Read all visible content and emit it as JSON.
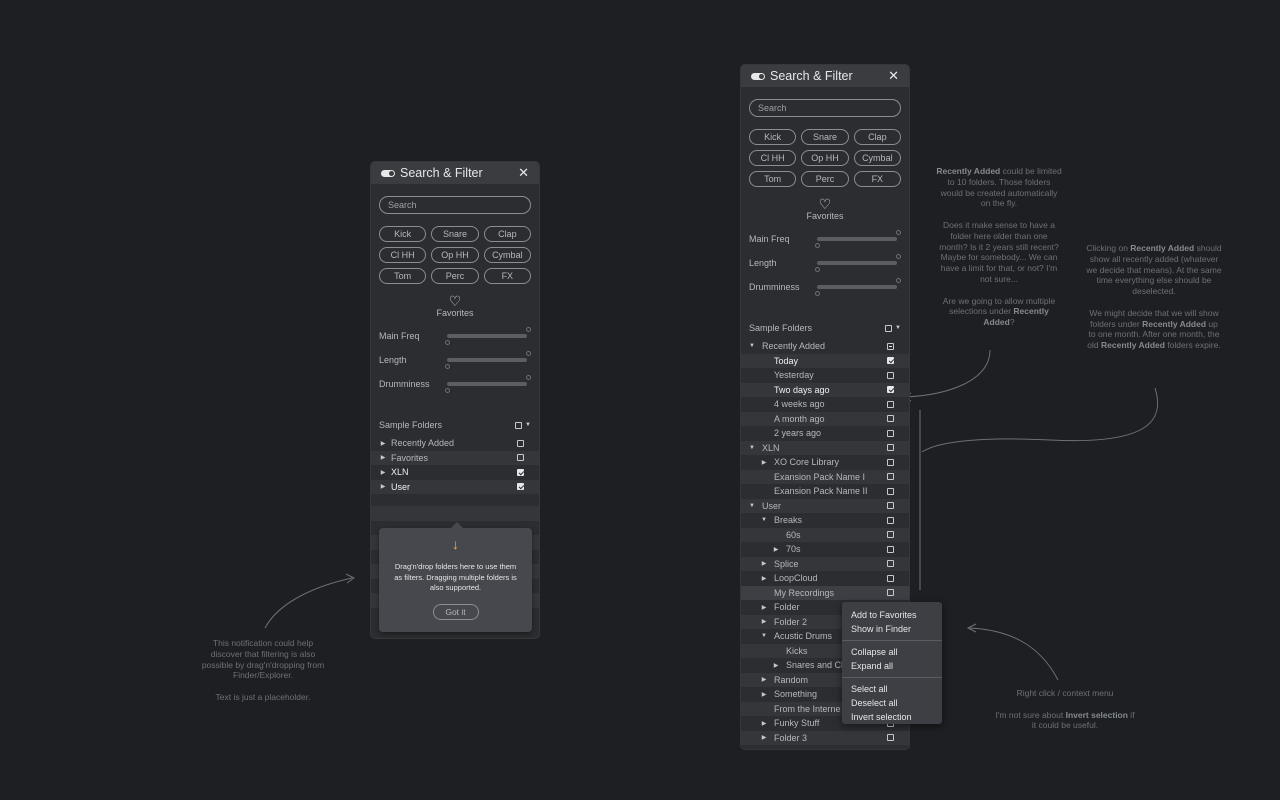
{
  "panel_left": {
    "title": "Search & Filter",
    "search_placeholder": "Search",
    "tags": [
      "Kick",
      "Snare",
      "Clap",
      "Cl HH",
      "Op HH",
      "Cymbal",
      "Tom",
      "Perc",
      "FX"
    ],
    "favorites_label": "Favorites",
    "sliders": [
      "Main Freq",
      "Length",
      "Drumminess"
    ],
    "sample_folders_label": "Sample Folders",
    "folders": [
      {
        "label": "Recently Added",
        "checked": false
      },
      {
        "label": "Favorites",
        "checked": false
      },
      {
        "label": "XLN",
        "checked": true
      },
      {
        "label": "User",
        "checked": true
      }
    ],
    "tooltip": {
      "message": "Drag'n'drop folders here to use them as filters. Dragging multiple folders is also supported.",
      "button": "Got it"
    }
  },
  "panel_right": {
    "title": "Search & Filter",
    "search_placeholder": "Search",
    "tags": [
      "Kick",
      "Snare",
      "Clap",
      "Cl HH",
      "Op HH",
      "Cymbal",
      "Tom",
      "Perc",
      "FX"
    ],
    "favorites_label": "Favorites",
    "sliders": [
      "Main Freq",
      "Length",
      "Drumminess"
    ],
    "sample_folders_label": "Sample Folders",
    "tree": [
      {
        "label": "Recently Added",
        "indent": 0,
        "caret": "down",
        "state": "partial"
      },
      {
        "label": "Today",
        "indent": 1,
        "caret": "",
        "state": "checked"
      },
      {
        "label": "Yesterday",
        "indent": 1,
        "caret": "",
        "state": "empty"
      },
      {
        "label": "Two days ago",
        "indent": 1,
        "caret": "",
        "state": "checked"
      },
      {
        "label": "4 weeks ago",
        "indent": 1,
        "caret": "",
        "state": "empty"
      },
      {
        "label": "A month ago",
        "indent": 1,
        "caret": "",
        "state": "empty"
      },
      {
        "label": "2 years ago",
        "indent": 1,
        "caret": "",
        "state": "empty"
      },
      {
        "label": "XLN",
        "indent": 0,
        "caret": "down",
        "state": "empty"
      },
      {
        "label": "XO Core Library",
        "indent": 1,
        "caret": "right",
        "state": "empty"
      },
      {
        "label": "Exansion Pack Name I",
        "indent": 1,
        "caret": "",
        "state": "empty"
      },
      {
        "label": "Exansion Pack Name II",
        "indent": 1,
        "caret": "",
        "state": "empty"
      },
      {
        "label": "User",
        "indent": 0,
        "caret": "down",
        "state": "empty"
      },
      {
        "label": "Breaks",
        "indent": 1,
        "caret": "down",
        "state": "empty"
      },
      {
        "label": "60s",
        "indent": 2,
        "caret": "",
        "state": "empty"
      },
      {
        "label": "70s",
        "indent": 2,
        "caret": "right",
        "state": "empty"
      },
      {
        "label": "Splice",
        "indent": 1,
        "caret": "right",
        "state": "empty"
      },
      {
        "label": "LoopCloud",
        "indent": 1,
        "caret": "right",
        "state": "empty"
      },
      {
        "label": "My Recordings",
        "indent": 1,
        "caret": "",
        "state": "empty"
      },
      {
        "label": "Folder",
        "indent": 1,
        "caret": "right",
        "state": "empty"
      },
      {
        "label": "Folder 2",
        "indent": 1,
        "caret": "right",
        "state": "empty"
      },
      {
        "label": "Acustic Drums",
        "indent": 1,
        "caret": "down",
        "state": "empty"
      },
      {
        "label": "Kicks",
        "indent": 2,
        "caret": "",
        "state": "empty"
      },
      {
        "label": "Snares and Cl",
        "indent": 2,
        "caret": "right",
        "state": "empty"
      },
      {
        "label": "Random",
        "indent": 1,
        "caret": "right",
        "state": "empty"
      },
      {
        "label": "Something",
        "indent": 1,
        "caret": "right",
        "state": "empty"
      },
      {
        "label": "From the Interne",
        "indent": 1,
        "caret": "",
        "state": "empty"
      },
      {
        "label": "Funky Stuff",
        "indent": 1,
        "caret": "right",
        "state": "empty"
      },
      {
        "label": "Folder 3",
        "indent": 1,
        "caret": "right",
        "state": "empty"
      }
    ]
  },
  "context_menu": {
    "groups": [
      [
        "Add to Favorites",
        "Show in Finder"
      ],
      [
        "Collapse all",
        "Expand all"
      ],
      [
        "Select all",
        "Deselect all",
        "Invert selection"
      ]
    ]
  },
  "notes": {
    "left": {
      "p1": "This notification could help discover that filtering is also possible by drag'n'dropping from Finder/Explorer.",
      "p2": "Text is just a placeholder."
    },
    "recent": {
      "p1_bold": "Recently Added",
      "p1_rest": " could be limited to 10 folders. Those folders would be created automatically on the fly.",
      "p2": "Does it make sense to have a folder here older than one month? Is it 2 years still recent? Maybe for somebody... We can have a limit for that, or not? I'm not sure...",
      "p3_pre": "Are we going to allow multiple selections under ",
      "p3_bold": "Recently Added",
      "p3_post": "?"
    },
    "click": {
      "p1_pre": "Clicking on ",
      "p1_bold": "Recently Added",
      "p1_post": " should show all recently added (whatever we decide that means). At the same time everything else should be deselected.",
      "p2_pre": "We might decide that we will show folders under ",
      "p2_bold": "Recently Added",
      "p2_mid": " up to one month. After one month, the old ",
      "p2_bold2": "Recently Added",
      "p2_post": " folders expire."
    },
    "ctx": {
      "p1": "Right click / context menu",
      "p2_pre": "I'm not sure about ",
      "p2_bold": "Invert selection",
      "p2_post": " if it could be useful."
    }
  }
}
